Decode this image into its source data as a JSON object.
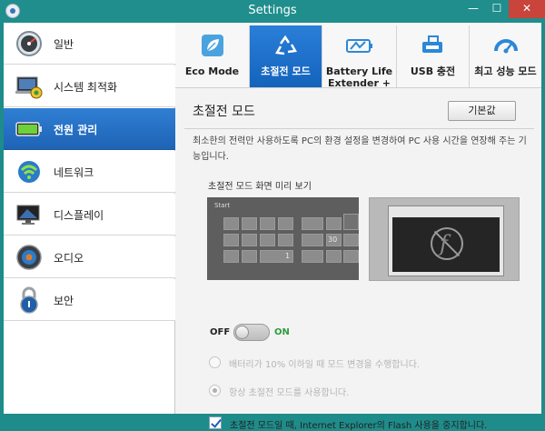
{
  "window": {
    "title": "Settings",
    "minimize": "—",
    "maximize": "☐",
    "close": "✕"
  },
  "sidebar": {
    "items": [
      {
        "label": "일반",
        "icon": "gauge-icon"
      },
      {
        "label": "시스템 최적화",
        "icon": "laptop-optimize-icon"
      },
      {
        "label": "전원 관리",
        "icon": "battery-icon",
        "active": true
      },
      {
        "label": "네트워크",
        "icon": "wifi-globe-icon"
      },
      {
        "label": "디스플레이",
        "icon": "display-icon"
      },
      {
        "label": "오디오",
        "icon": "speaker-icon"
      },
      {
        "label": "보안",
        "icon": "lock-icon"
      }
    ]
  },
  "tabs": [
    {
      "label": "Eco Mode",
      "icon": "leaf-icon"
    },
    {
      "label": "초절전 모드",
      "icon": "recycle-icon",
      "active": true
    },
    {
      "label": "Battery Life Extender +",
      "icon": "battery-extender-icon"
    },
    {
      "label": "USB 충전",
      "icon": "usb-charge-icon"
    },
    {
      "label": "최고 성능 모드",
      "icon": "speedometer-icon"
    }
  ],
  "content": {
    "title": "초절전 모드",
    "default_button": "기본값",
    "description": "최소한의 전력만 사용하도록 PC의 환경 설정을 변경하여 PC 사용 시간을 연장해 주는 기능입니다.",
    "preview_label": "초절전 모드 화면 미리 보기",
    "start_screen_label": "Start",
    "tile_number_1": "1",
    "tile_number_2": "30",
    "toggle": {
      "off_label": "OFF",
      "on_label": "ON",
      "state": "off"
    },
    "radio_options": [
      {
        "label": "배터리가 10% 이하일 때 모드 변경을 수행합니다.",
        "selected": false
      },
      {
        "label": "항상 초절전 모드를 사용합니다.",
        "selected": true
      }
    ],
    "checkbox": {
      "label": "초절전 모드일 때, Internet Explorer의 Flash 사용을 중지합니다.",
      "checked": true
    },
    "flash_glyph": "f"
  }
}
